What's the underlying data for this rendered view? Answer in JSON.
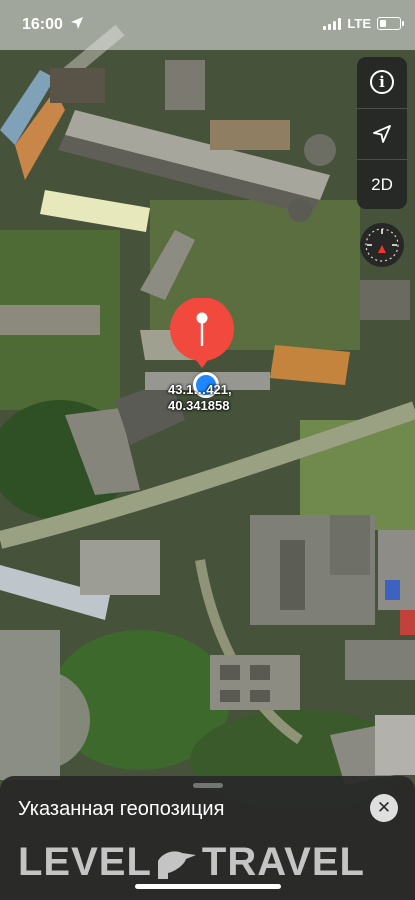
{
  "status_bar": {
    "time": "16:00",
    "network": "LTE",
    "location_icon": "location-arrow-icon",
    "signal_icon": "signal-bars-icon",
    "battery_icon": "battery-icon"
  },
  "map_controls": {
    "info_icon": "info-icon",
    "locate_icon": "location-arrow-icon",
    "view_mode_label": "2D",
    "compass_icon": "compass-icon"
  },
  "marker": {
    "pin_icon": "map-pin-icon",
    "pin_color": "#f2493f",
    "user_location_color": "#1f87ff",
    "latitude": "43.1…421,",
    "longitude": "40.341858"
  },
  "sheet": {
    "title": "Указанная геопозиция",
    "close_icon": "close-icon"
  },
  "watermark": {
    "left": "LEVEL",
    "right": "TRAVEL",
    "logo_icon": "bird-logo-icon"
  }
}
